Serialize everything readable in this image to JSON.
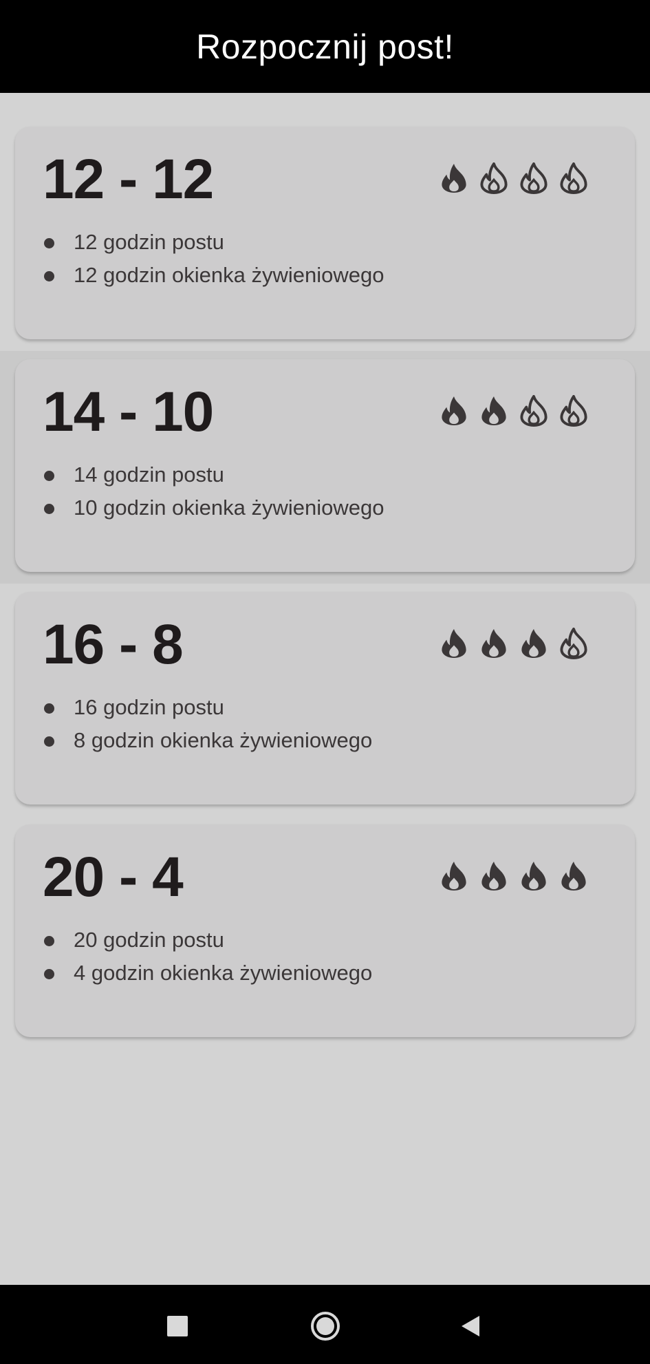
{
  "header": {
    "title": "Rozpocznij post!"
  },
  "plans": [
    {
      "title": "12 - 12",
      "fasting": "12 godzin postu",
      "eating": "12 godzin okienka żywieniowego",
      "intensity": 1,
      "selected": false
    },
    {
      "title": "14 - 10",
      "fasting": "14 godzin postu",
      "eating": "10 godzin okienka żywieniowego",
      "intensity": 2,
      "selected": true
    },
    {
      "title": "16 - 8",
      "fasting": "16 godzin postu",
      "eating": "8 godzin okienka żywieniowego",
      "intensity": 3,
      "selected": false
    },
    {
      "title": "20 - 4",
      "fasting": "20 godzin postu",
      "eating": "4 godzin okienka żywieniowego",
      "intensity": 4,
      "selected": false
    }
  ],
  "flame_scale_max": 4,
  "colors": {
    "header_bg": "#000000",
    "card_bg": "#cdcccd",
    "text_dark": "#1f1b1c",
    "icon": "#3b3738"
  },
  "navbar": {
    "icons": [
      "recent-apps-icon",
      "home-icon",
      "back-icon"
    ]
  }
}
